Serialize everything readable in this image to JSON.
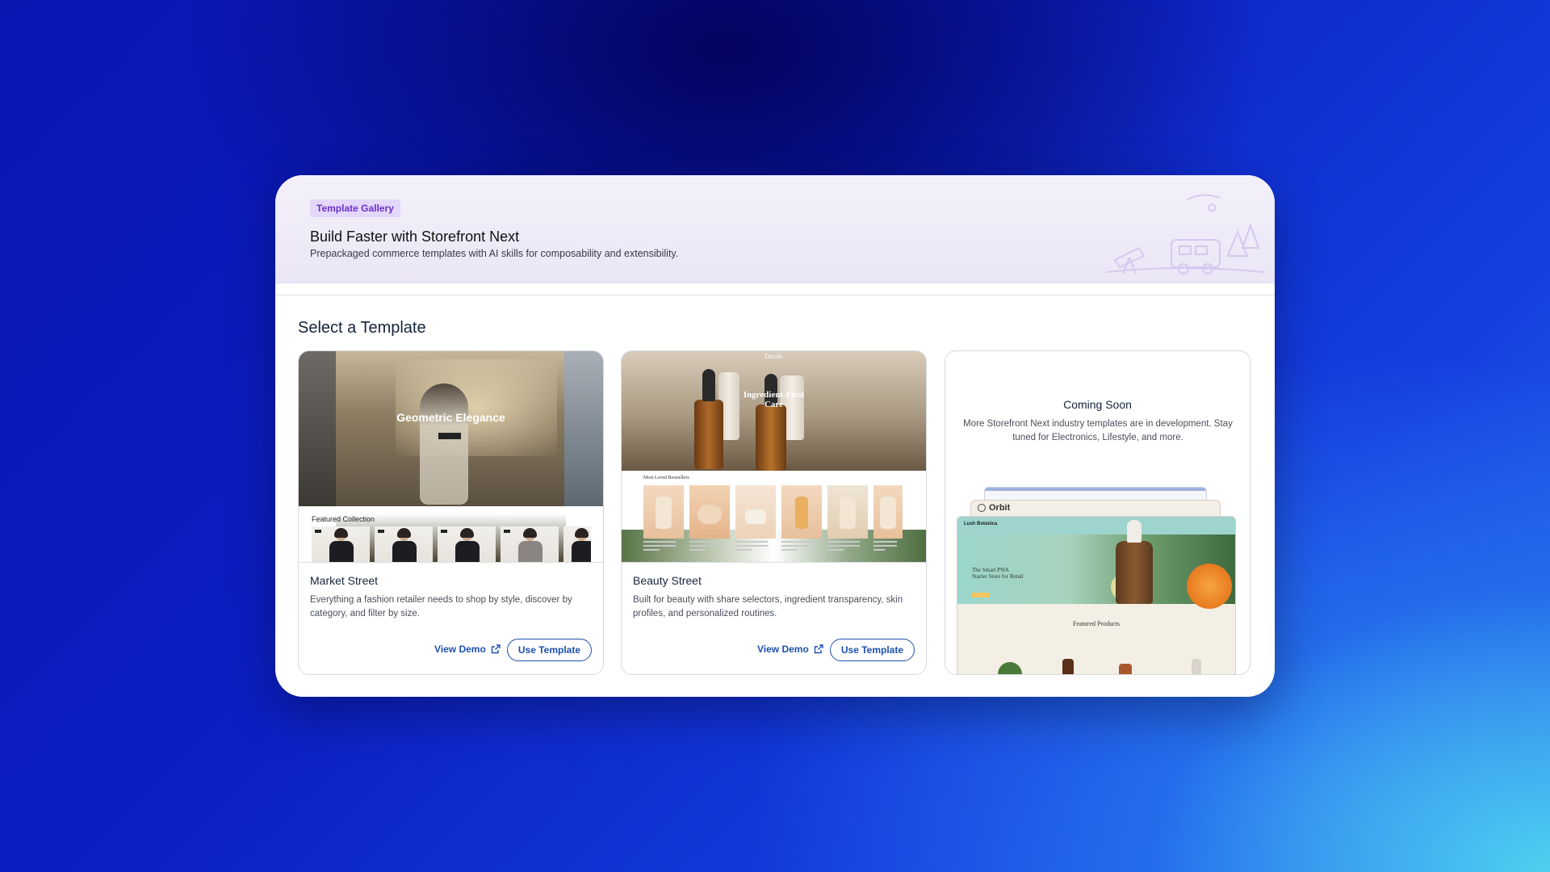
{
  "hero": {
    "badge": "Template Gallery",
    "title": "Build Faster with Storefront Next",
    "subtitle": "Prepackaged commerce templates with AI skills for composability and extensibility."
  },
  "section_title": "Select a Template",
  "cards": [
    {
      "name": "Market Street",
      "description": "Everything a fashion retailer needs to shop by style, discover by category, and filter by size.",
      "view_demo": "View Demo",
      "use_template": "Use Template",
      "preview": {
        "hero_title": "Geometric Elegance",
        "featured": "Featured Collection"
      }
    },
    {
      "name": "Beauty Street",
      "description": "Built for beauty with share selectors, ingredient transparency, skin profiles, and personalized routines.",
      "view_demo": "View Demo",
      "use_template": "Use Template",
      "preview": {
        "logo": "Dazzle",
        "hero_title_line1": "Ingredient-First",
        "hero_title_line2": "Care",
        "section": "Most Loved Bestsellers"
      }
    },
    {
      "name": "Coming Soon",
      "description": "More Storefront Next industry templates are in development. Stay tuned for Electronics, Lifestyle, and more.",
      "preview": {
        "orbit_label": "Orbit",
        "brand": "Lush Botanica",
        "hero_line1": "The Smart PWA",
        "hero_line2": "Starter Store for Retail",
        "featured": "Featured Products"
      }
    }
  ],
  "colors": {
    "badge_bg": "#e3d8fb",
    "badge_text": "#6b2fc9",
    "link": "#1e4fb0"
  },
  "icons": [
    "external-link-icon",
    "orbit-logo-icon"
  ]
}
